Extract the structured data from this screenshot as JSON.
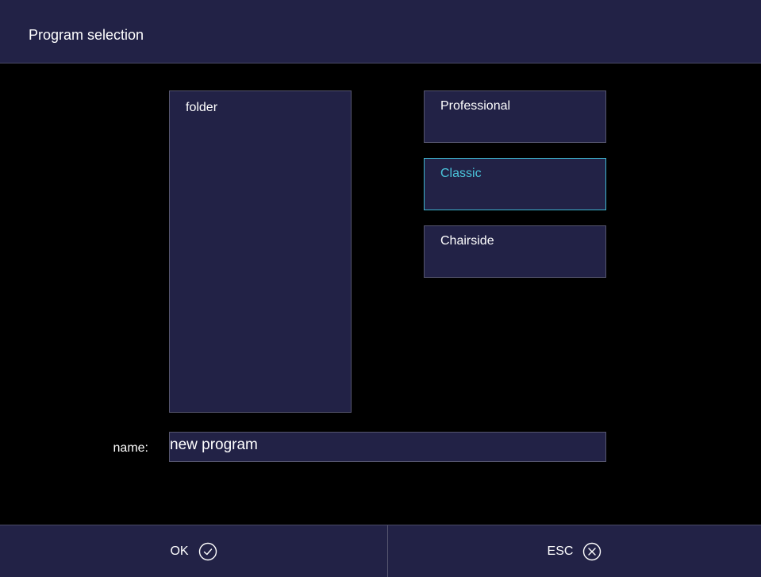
{
  "window": {
    "title": "Program selection"
  },
  "folders": {
    "items": [
      "folder"
    ]
  },
  "modes": [
    {
      "label": "Professional",
      "selected": false
    },
    {
      "label": "Classic",
      "selected": true
    },
    {
      "label": "Chairside",
      "selected": false
    }
  ],
  "name_field": {
    "label": "name:",
    "value": "new program"
  },
  "footer": {
    "ok_label": "OK",
    "ok_icon": "check-circle-icon",
    "esc_label": "ESC",
    "esc_icon": "x-circle-icon"
  },
  "colors": {
    "panel": "#222246",
    "accent": "#4ac3da",
    "background": "#000000"
  }
}
